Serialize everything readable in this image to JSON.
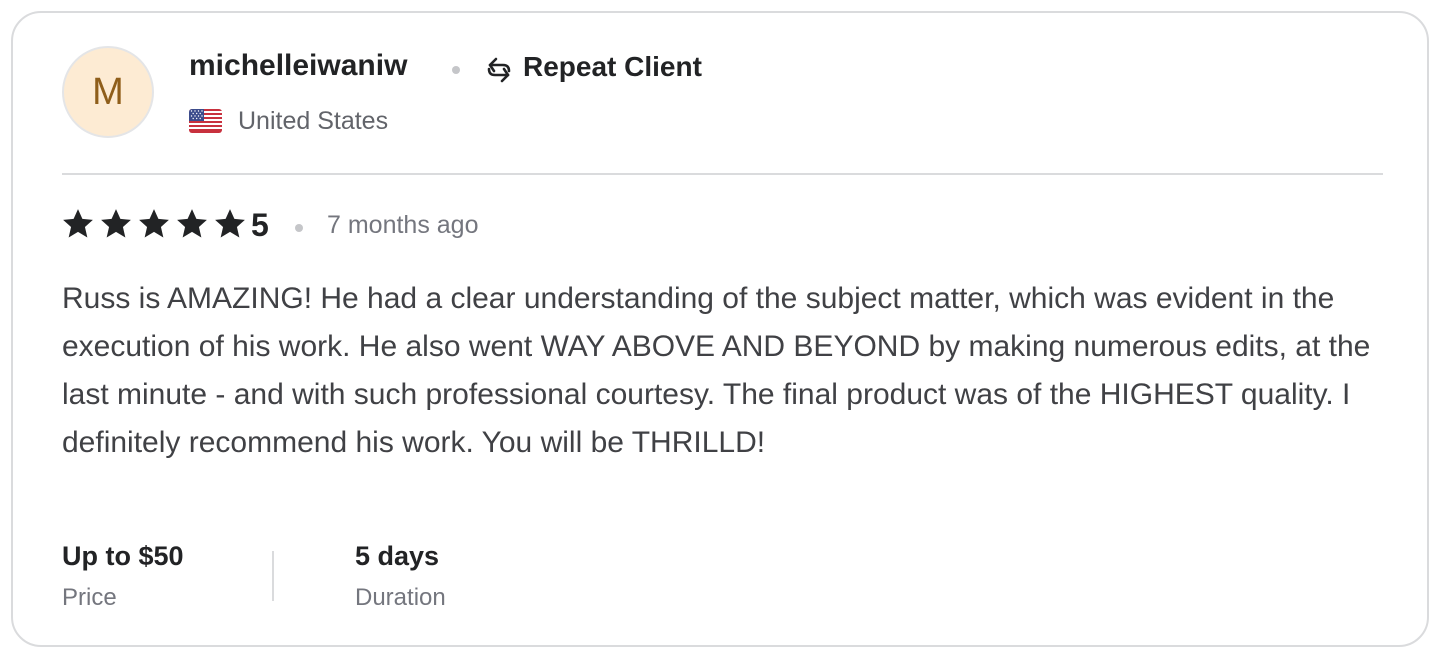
{
  "reviewer": {
    "avatar_initial": "M",
    "username": "michelleiwaniw",
    "badge_label": "Repeat Client",
    "badge_icon": "repeat-icon",
    "country": "United States",
    "country_flag": "us-flag-icon"
  },
  "review": {
    "stars": 5,
    "rating": "5",
    "time_ago": "7 months ago",
    "text": "Russ is AMAZING! He had a clear understanding of the subject matter, which was evident in the execution of his work. He also went WAY ABOVE AND BEYOND by making numerous edits, at the last minute - and with such professional courtesy. The final product was of the HIGHEST quality. I definitely recommend his work. You will be THRILLD!"
  },
  "details": {
    "price_value": "Up to $50",
    "price_label": "Price",
    "duration_value": "5 days",
    "duration_label": "Duration"
  },
  "colors": {
    "avatar_bg": "#fdebd3",
    "avatar_text": "#8f5e1a",
    "star": "#222325",
    "border": "#dadbdd"
  }
}
